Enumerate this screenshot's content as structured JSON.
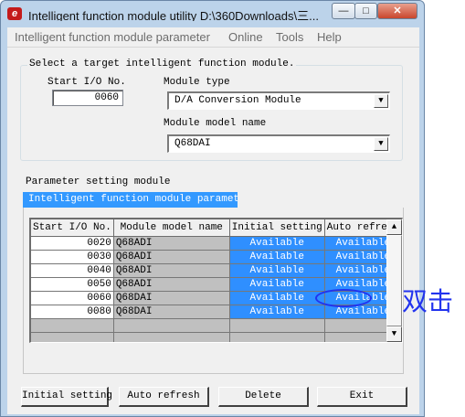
{
  "window": {
    "title": "Intelligent function module utility D:\\360Downloads\\三...",
    "minimize_glyph": "—",
    "maximize_glyph": "□",
    "close_glyph": "✕"
  },
  "menu": [
    "Intelligent function module parameter",
    "Online",
    "Tools",
    "Help"
  ],
  "target": {
    "legend": "Select a target intelligent function module.",
    "start_io_label": "Start I/O No.",
    "start_io_value": "0060",
    "module_type_label": "Module type",
    "module_type_value": "D/A Conversion Module",
    "model_name_label": "Module model name",
    "model_name_value": "Q68DAI"
  },
  "param_section": {
    "label": "Parameter setting module",
    "tab": "Intelligent function module parameter"
  },
  "table": {
    "headers": [
      "Start I/O No.",
      "Module model name",
      "Initial setting",
      "Auto refresh"
    ],
    "rows": [
      {
        "io": "0020",
        "model": "Q68ADI",
        "initial": "Available",
        "auto": "Available"
      },
      {
        "io": "0030",
        "model": "Q68ADI",
        "initial": "Available",
        "auto": "Available"
      },
      {
        "io": "0040",
        "model": "Q68ADI",
        "initial": "Available",
        "auto": "Available"
      },
      {
        "io": "0050",
        "model": "Q68ADI",
        "initial": "Available",
        "auto": "Available"
      },
      {
        "io": "0060",
        "model": "Q68DAI",
        "initial": "Available",
        "auto": "Available"
      },
      {
        "io": "0080",
        "model": "Q68DAI",
        "initial": "Available",
        "auto": "Available"
      }
    ],
    "empty_rows": 2,
    "scroll_up_glyph": "▲",
    "scroll_down_glyph": "▼"
  },
  "annotation": "双击",
  "buttons": {
    "initial_setting": "Initial setting",
    "auto_refresh": "Auto refresh",
    "delete": "Delete",
    "exit": "Exit"
  },
  "colors": {
    "window_frame": "#bcd3ea",
    "selection_blue": "#2f8fff",
    "annotation_blue": "#2233ee",
    "grey_cell": "#c0c0c0"
  },
  "icons": {
    "app": "app-logo-icon",
    "combo_arrow": "chevron-down-icon"
  }
}
